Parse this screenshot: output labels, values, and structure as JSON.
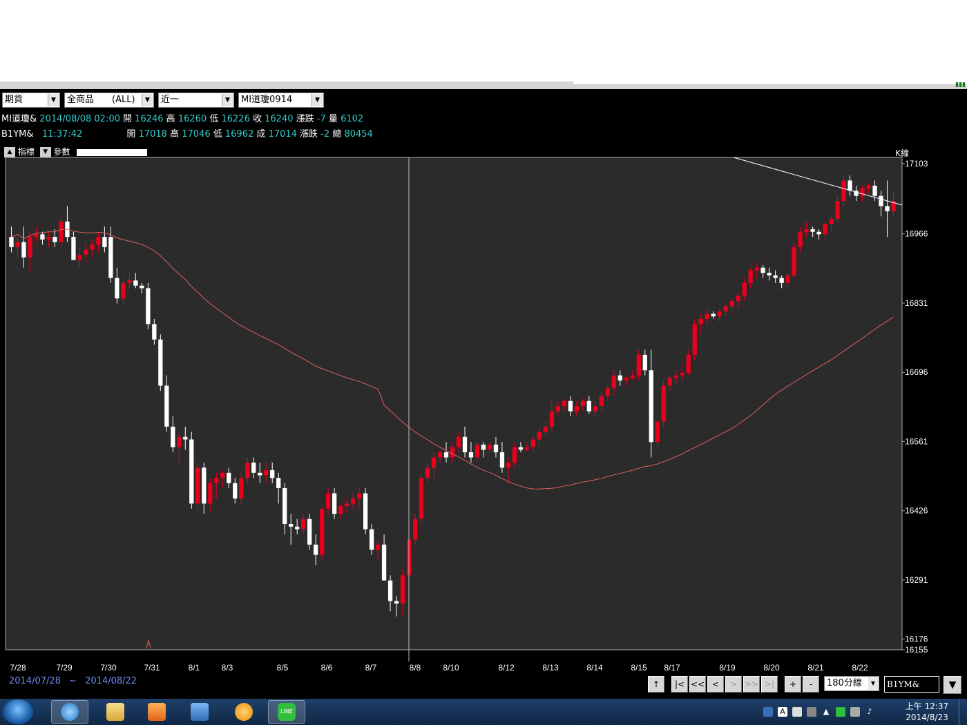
{
  "toolbar": {
    "market": "期貨",
    "product": "全商品　　(ALL)",
    "period": "近一",
    "contract": "MI道瓊0914"
  },
  "quotes": [
    {
      "symbol": "MI道瓊&",
      "time": "2014/08/08 02:00",
      "open_label": "開",
      "open": "16246",
      "high_label": "高",
      "high": "16260",
      "low_label": "低",
      "low": "16226",
      "close_label": "收",
      "close": "16240",
      "change_label": "漲跌",
      "change": "-7",
      "vol_label": "量",
      "vol": "6102"
    },
    {
      "symbol": "B1YM&",
      "time": "11:37:42",
      "open_label": "開",
      "open": "17018",
      "high_label": "高",
      "high": "17046",
      "low_label": "低",
      "low": "16962",
      "close_label": "成",
      "close": "17014",
      "change_label": "漲跌",
      "change": "-2",
      "vol_label": "總",
      "vol": "80454"
    }
  ],
  "tools": {
    "indicator": "指標",
    "param": "參數",
    "mode": "K線"
  },
  "chart_data": {
    "type": "candlestick",
    "interval": "180分線",
    "x_labels": [
      "7/28",
      "7/29",
      "7/30",
      "7/31",
      "8/1",
      "8/3",
      "8/5",
      "8/6",
      "8/7",
      "8/8",
      "8/10",
      "8/12",
      "8/13",
      "8/14",
      "8/15",
      "8/17",
      "8/19",
      "8/20",
      "8/21",
      "8/22"
    ],
    "y_ticks": [
      17103,
      16966,
      16831,
      16696,
      16561,
      16426,
      16291,
      16176,
      16155
    ],
    "ylim": [
      16155,
      17115
    ],
    "up_color": "#e8001c",
    "down_color": "#ffffff",
    "ma_color": "#e06060",
    "trend_color": "#ffffff",
    "crosshair_label": "8/8",
    "candles": [
      [
        16960,
        16980,
        16930,
        16940
      ],
      [
        16940,
        16960,
        16920,
        16950
      ],
      [
        16950,
        16980,
        16900,
        16920
      ],
      [
        16920,
        16970,
        16890,
        16960
      ],
      [
        16960,
        16980,
        16950,
        16965
      ],
      [
        16965,
        16970,
        16945,
        16955
      ],
      [
        16955,
        16970,
        16940,
        16960
      ],
      [
        16960,
        16975,
        16940,
        16950
      ],
      [
        16950,
        17000,
        16940,
        16990
      ],
      [
        16990,
        17020,
        16950,
        16960
      ],
      [
        16960,
        16970,
        16920,
        16915
      ],
      [
        16915,
        16940,
        16900,
        16925
      ],
      [
        16925,
        16950,
        16910,
        16935
      ],
      [
        16935,
        16955,
        16920,
        16945
      ],
      [
        16945,
        16970,
        16930,
        16960
      ],
      [
        16960,
        16980,
        16930,
        16940
      ],
      [
        16960,
        16980,
        16870,
        16880
      ],
      [
        16880,
        16900,
        16830,
        16840
      ],
      [
        16840,
        16880,
        16830,
        16870
      ],
      [
        16870,
        16890,
        16860,
        16875
      ],
      [
        16875,
        16890,
        16860,
        16865
      ],
      [
        16865,
        16870,
        16850,
        16860
      ],
      [
        16860,
        16870,
        16780,
        16790
      ],
      [
        16790,
        16800,
        16750,
        16760
      ],
      [
        16760,
        16770,
        16660,
        16670
      ],
      [
        16670,
        16690,
        16580,
        16590
      ],
      [
        16590,
        16610,
        16540,
        16550
      ],
      [
        16550,
        16580,
        16520,
        16570
      ],
      [
        16570,
        16590,
        16545,
        16565
      ],
      [
        16565,
        16580,
        16430,
        16440
      ],
      [
        16440,
        16520,
        16430,
        16510
      ],
      [
        16510,
        16520,
        16420,
        16440
      ],
      [
        16440,
        16490,
        16425,
        16480
      ],
      [
        16480,
        16500,
        16450,
        16490
      ],
      [
        16490,
        16505,
        16470,
        16500
      ],
      [
        16500,
        16510,
        16470,
        16480
      ],
      [
        16480,
        16490,
        16440,
        16450
      ],
      [
        16450,
        16500,
        16440,
        16490
      ],
      [
        16490,
        16530,
        16480,
        16520
      ],
      [
        16520,
        16530,
        16490,
        16500
      ],
      [
        16500,
        16520,
        16480,
        16495
      ],
      [
        16495,
        16520,
        16480,
        16505
      ],
      [
        16505,
        16520,
        16480,
        16490
      ],
      [
        16490,
        16500,
        16440,
        16470
      ],
      [
        16470,
        16480,
        16380,
        16400
      ],
      [
        16400,
        16420,
        16360,
        16395
      ],
      [
        16395,
        16410,
        16380,
        16390
      ],
      [
        16390,
        16420,
        16380,
        16410
      ],
      [
        16410,
        16420,
        16350,
        16360
      ],
      [
        16360,
        16380,
        16320,
        16340
      ],
      [
        16340,
        16430,
        16330,
        16430
      ],
      [
        16430,
        16470,
        16420,
        16460
      ],
      [
        16460,
        16470,
        16410,
        16420
      ],
      [
        16420,
        16440,
        16410,
        16435
      ],
      [
        16435,
        16450,
        16420,
        16440
      ],
      [
        16440,
        16460,
        16430,
        16450
      ],
      [
        16450,
        16470,
        16430,
        16460
      ],
      [
        16460,
        16470,
        16380,
        16390
      ],
      [
        16390,
        16400,
        16340,
        16350
      ],
      [
        16350,
        16370,
        16330,
        16360
      ],
      [
        16360,
        16380,
        16300,
        16290
      ],
      [
        16290,
        16300,
        16230,
        16250
      ],
      [
        16250,
        16260,
        16220,
        16245
      ],
      [
        16245,
        16310,
        16220,
        16300
      ],
      [
        16300,
        16380,
        16290,
        16370
      ],
      [
        16370,
        16420,
        16360,
        16410
      ],
      [
        16410,
        16500,
        16400,
        16490
      ],
      [
        16490,
        16520,
        16480,
        16510
      ],
      [
        16510,
        16540,
        16490,
        16530
      ],
      [
        16530,
        16545,
        16520,
        16540
      ],
      [
        16540,
        16560,
        16520,
        16530
      ],
      [
        16530,
        16560,
        16520,
        16550
      ],
      [
        16550,
        16580,
        16540,
        16570
      ],
      [
        16570,
        16590,
        16530,
        16540
      ],
      [
        16540,
        16560,
        16520,
        16530
      ],
      [
        16530,
        16560,
        16520,
        16555
      ],
      [
        16555,
        16560,
        16530,
        16545
      ],
      [
        16545,
        16560,
        16540,
        16555
      ],
      [
        16555,
        16570,
        16530,
        16540
      ],
      [
        16540,
        16560,
        16500,
        16510
      ],
      [
        16510,
        16530,
        16480,
        16520
      ],
      [
        16520,
        16560,
        16510,
        16550
      ],
      [
        16550,
        16560,
        16540,
        16545
      ],
      [
        16545,
        16560,
        16540,
        16550
      ],
      [
        16550,
        16570,
        16540,
        16565
      ],
      [
        16565,
        16590,
        16550,
        16580
      ],
      [
        16580,
        16600,
        16570,
        16590
      ],
      [
        16590,
        16640,
        16580,
        16620
      ],
      [
        16620,
        16640,
        16610,
        16630
      ],
      [
        16630,
        16645,
        16620,
        16640
      ],
      [
        16640,
        16650,
        16610,
        16620
      ],
      [
        16620,
        16640,
        16610,
        16630
      ],
      [
        16630,
        16645,
        16620,
        16640
      ],
      [
        16640,
        16650,
        16615,
        16620
      ],
      [
        16620,
        16640,
        16610,
        16630
      ],
      [
        16630,
        16660,
        16620,
        16650
      ],
      [
        16650,
        16670,
        16640,
        16665
      ],
      [
        16665,
        16700,
        16650,
        16690
      ],
      [
        16690,
        16700,
        16670,
        16680
      ],
      [
        16680,
        16690,
        16670,
        16685
      ],
      [
        16685,
        16700,
        16680,
        16690
      ],
      [
        16690,
        16740,
        16680,
        16730
      ],
      [
        16730,
        16740,
        16690,
        16700
      ],
      [
        16700,
        16740,
        16530,
        16560
      ],
      [
        16560,
        16580,
        16550,
        16600
      ],
      [
        16600,
        16680,
        16590,
        16670
      ],
      [
        16670,
        16690,
        16660,
        16685
      ],
      [
        16685,
        16700,
        16670,
        16690
      ],
      [
        16690,
        16710,
        16680,
        16695
      ],
      [
        16695,
        16740,
        16690,
        16730
      ],
      [
        16730,
        16800,
        16720,
        16790
      ],
      [
        16790,
        16810,
        16770,
        16800
      ],
      [
        16800,
        16820,
        16790,
        16810
      ],
      [
        16810,
        16815,
        16800,
        16805
      ],
      [
        16805,
        16820,
        16795,
        16815
      ],
      [
        16815,
        16830,
        16805,
        16825
      ],
      [
        16825,
        16840,
        16810,
        16835
      ],
      [
        16835,
        16850,
        16820,
        16845
      ],
      [
        16845,
        16880,
        16835,
        16870
      ],
      [
        16870,
        16900,
        16860,
        16895
      ],
      [
        16895,
        16910,
        16880,
        16900
      ],
      [
        16900,
        16905,
        16880,
        16890
      ],
      [
        16890,
        16900,
        16875,
        16885
      ],
      [
        16885,
        16895,
        16870,
        16880
      ],
      [
        16880,
        16885,
        16860,
        16870
      ],
      [
        16870,
        16890,
        16860,
        16885
      ],
      [
        16885,
        16950,
        16880,
        16940
      ],
      [
        16940,
        16980,
        16930,
        16970
      ],
      [
        16970,
        16990,
        16960,
        16975
      ],
      [
        16975,
        16980,
        16960,
        16970
      ],
      [
        16970,
        16975,
        16955,
        16965
      ],
      [
        16965,
        16990,
        16950,
        16985
      ],
      [
        16985,
        17000,
        16970,
        16995
      ],
      [
        16995,
        17040,
        16990,
        17030
      ],
      [
        17030,
        17080,
        17020,
        17070
      ],
      [
        17070,
        17080,
        17040,
        17050
      ],
      [
        17050,
        17060,
        17030,
        17040
      ],
      [
        17040,
        17060,
        17030,
        17055
      ],
      [
        17055,
        17065,
        17045,
        17060
      ],
      [
        17060,
        17070,
        17030,
        17040
      ],
      [
        17040,
        17050,
        17000,
        17020
      ],
      [
        17020,
        17070,
        16960,
        17010
      ],
      [
        17010,
        17050,
        17000,
        17030
      ]
    ]
  },
  "bottom": {
    "date_from": "2014/07/28",
    "date_sep": "~",
    "date_to": "2014/08/22",
    "nav": [
      "↑",
      "|<",
      "<<",
      "<",
      ">",
      ">>",
      ">|",
      "+",
      "-"
    ],
    "period_select": "180分線",
    "symbol_input": "B1YM&"
  },
  "taskbar": {
    "apps": [
      "internet-explorer",
      "file-explorer",
      "media-player",
      "settings",
      "browser",
      "line"
    ],
    "clock_time": "上午 12:37",
    "clock_date": "2014/8/23"
  }
}
